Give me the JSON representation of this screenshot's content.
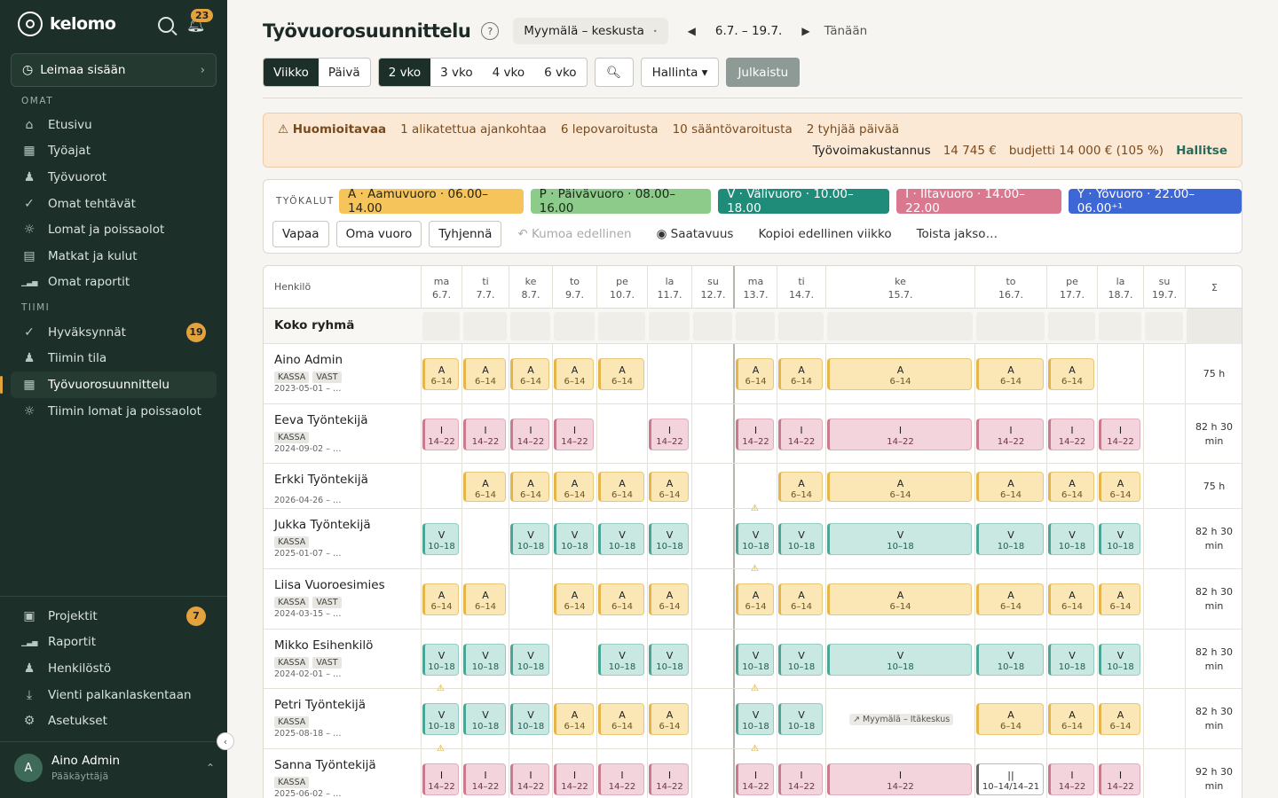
{
  "sidebar": {
    "brand": "kelomo",
    "notif_count": "23",
    "clock_in": "Leimaa sisään",
    "section_own": "OMAT",
    "own_items": [
      {
        "label": "Etusivu",
        "icon": "home-icon"
      },
      {
        "label": "Työajat",
        "icon": "calendar-icon"
      },
      {
        "label": "Työvuorot",
        "icon": "people-icon"
      },
      {
        "label": "Omat tehtävät",
        "icon": "check-icon"
      },
      {
        "label": "Lomat ja poissaolot",
        "icon": "sun-icon"
      },
      {
        "label": "Matkat ja kulut",
        "icon": "receipt-icon"
      },
      {
        "label": "Omat raportit",
        "icon": "bar-chart-icon"
      }
    ],
    "section_team": "TIIMI",
    "team_items": [
      {
        "label": "Hyväksynnät",
        "icon": "check-icon",
        "badge": "19"
      },
      {
        "label": "Tiimin tila",
        "icon": "people-icon"
      },
      {
        "label": "Työvuorosuunnittelu",
        "icon": "calendar-icon",
        "active": true
      },
      {
        "label": "Tiimin lomat ja poissaolot",
        "icon": "sun-icon"
      }
    ],
    "bottom_items": [
      {
        "label": "Projektit",
        "icon": "briefcase-icon",
        "badge": "7"
      },
      {
        "label": "Raportit",
        "icon": "bar-chart-icon"
      },
      {
        "label": "Henkilöstö",
        "icon": "people-icon"
      },
      {
        "label": "Vienti palkanlaskentaan",
        "icon": "download-icon"
      },
      {
        "label": "Asetukset",
        "icon": "gear-icon"
      }
    ],
    "user": {
      "initial": "A",
      "name": "Aino Admin",
      "role": "Pääkäyttäjä"
    }
  },
  "header": {
    "title": "Työvuorosuunnittelu",
    "help": "?",
    "store": "Myymälä – keskusta",
    "range": "6.7. – 19.7.",
    "today": "Tänään"
  },
  "toolbar": {
    "view": [
      "Viikko",
      "Päivä"
    ],
    "span": [
      "2 vko",
      "3 vko",
      "4 vko",
      "6 vko"
    ],
    "manage": "Hallinta ▾",
    "publish": "Julkaistu"
  },
  "alert": {
    "heading": "⚠ Huomioitavaa",
    "items": [
      "1 alikatettua ajankohtaa",
      "6 lepovaroitusta",
      "10 sääntövaroitusta",
      "2 tyhjää päivää"
    ],
    "cost_label": "Työvoimakustannus",
    "cost": "14 745 €",
    "budget": "budjetti 14 000 € (105 %)",
    "manage": "Hallitse"
  },
  "tools": {
    "label": "TYÖKALUT",
    "shift_types": [
      {
        "label": "A · Aamuvuoro · 06.00–14.00",
        "bg": "#f5c45a",
        "fg": "#2a2410"
      },
      {
        "label": "P · Päivävuoro · 08.00–16.00",
        "bg": "#8ccb8a",
        "fg": "#152a14"
      },
      {
        "label": "V · Välivuoro · 10.00–18.00",
        "bg": "#1f8c7a",
        "fg": "#ffffff"
      },
      {
        "label": "I · Iltavuoro · 14.00–22.00",
        "bg": "#d9788e",
        "fg": "#ffffff"
      },
      {
        "label": "Y · Yövuoro · 22.00–06.00⁺¹",
        "bg": "#3e67d6",
        "fg": "#ffffff"
      }
    ],
    "buttons": [
      "Vapaa",
      "Oma vuoro",
      "Tyhjennä"
    ],
    "undo": "↶ Kumoa edellinen",
    "availability": "Saatavuus",
    "copy_prev": "Kopioi edellinen viikko",
    "repeat": "Toista jakso…"
  },
  "schedule": {
    "person_header": "Henkilö",
    "sum_header": "Σ",
    "days": [
      {
        "d": "ma",
        "date": "6.7."
      },
      {
        "d": "ti",
        "date": "7.7."
      },
      {
        "d": "ke",
        "date": "8.7."
      },
      {
        "d": "to",
        "date": "9.7."
      },
      {
        "d": "pe",
        "date": "10.7."
      },
      {
        "d": "la",
        "date": "11.7."
      },
      {
        "d": "su",
        "date": "12.7."
      },
      {
        "d": "ma",
        "date": "13.7."
      },
      {
        "d": "ti",
        "date": "14.7."
      },
      {
        "d": "ke",
        "date": "15.7."
      },
      {
        "d": "to",
        "date": "16.7."
      },
      {
        "d": "pe",
        "date": "17.7."
      },
      {
        "d": "la",
        "date": "18.7."
      },
      {
        "d": "su",
        "date": "19.7."
      }
    ],
    "group": "Koko ryhmä",
    "people": [
      {
        "name": "Aino Admin",
        "tags": [
          "KASSA",
          "VAST"
        ],
        "since": "2023-05-01 – …",
        "total": "75 h",
        "shifts": [
          "A|6–14",
          "A|6–14",
          "A|6–14",
          "A|6–14",
          "A|6–14",
          "",
          "",
          "A|6–14",
          "A|6–14",
          "A|6–14",
          "A|6–14",
          "A|6–14",
          "",
          ""
        ]
      },
      {
        "name": "Eeva Työntekijä",
        "tags": [
          "KASSA"
        ],
        "since": "2024-09-02 – …",
        "total": "82 h 30 min",
        "shifts": [
          "I|14–22",
          "I|14–22",
          "I|14–22",
          "I|14–22",
          "",
          "I|14–22",
          "",
          "I|14–22",
          "I|14–22",
          "I|14–22",
          "I|14–22",
          "I|14–22",
          "I|14–22",
          ""
        ]
      },
      {
        "name": "Erkki Työntekijä",
        "tags": [],
        "since": "2026-04-26 – …",
        "total": "75 h",
        "shifts": [
          "",
          "A|6–14",
          "A|6–14",
          "A|6–14",
          "A|6–14",
          "A|6–14",
          "",
          "",
          "A|6–14",
          "A|6–14",
          "A|6–14",
          "A|6–14",
          "A|6–14",
          ""
        ]
      },
      {
        "name": "Jukka Työntekijä",
        "tags": [
          "KASSA"
        ],
        "since": "2025-01-07 – …",
        "total": "82 h 30 min",
        "warn": [
          7
        ],
        "shifts": [
          "V|10–18",
          "",
          "V|10–18",
          "V|10–18",
          "V|10–18",
          "V|10–18",
          "",
          "V|10–18",
          "V|10–18",
          "V|10–18",
          "V|10–18",
          "V|10–18",
          "V|10–18",
          ""
        ]
      },
      {
        "name": "Liisa Vuoroesimies",
        "tags": [
          "KASSA",
          "VAST"
        ],
        "since": "2024-03-15 – …",
        "total": "82 h 30 min",
        "warn": [
          7
        ],
        "shifts": [
          "A|6–14",
          "A|6–14",
          "",
          "A|6–14",
          "A|6–14",
          "A|6–14",
          "",
          "A|6–14",
          "A|6–14",
          "A|6–14",
          "A|6–14",
          "A|6–14",
          "A|6–14",
          ""
        ]
      },
      {
        "name": "Mikko Esihenkilö",
        "tags": [
          "KASSA",
          "VAST"
        ],
        "since": "2024-02-01 – …",
        "total": "82 h 30 min",
        "shifts": [
          "V|10–18",
          "V|10–18",
          "V|10–18",
          "",
          "V|10–18",
          "V|10–18",
          "",
          "V|10–18",
          "V|10–18",
          "V|10–18",
          "V|10–18",
          "V|10–18",
          "V|10–18",
          ""
        ]
      },
      {
        "name": "Petri Työntekijä",
        "tags": [
          "KASSA"
        ],
        "since": "2025-08-18 – …",
        "total": "82 h 30 min",
        "warn": [
          0,
          7
        ],
        "loc": "↗ Myymälä – Itäkeskus",
        "shifts": [
          "V|10–18",
          "V|10–18",
          "V|10–18",
          "A|6–14",
          "A|6–14",
          "A|6–14",
          "",
          "V|10–18",
          "V|10–18",
          "LOC",
          "A|6–14",
          "A|6–14",
          "A|6–14",
          ""
        ]
      },
      {
        "name": "Sanna Työntekijä",
        "tags": [
          "KASSA"
        ],
        "since": "2025-06-02 – …",
        "total": "92 h 30 min",
        "warn": [
          0,
          7
        ],
        "shifts": [
          "I|14–22",
          "I|14–22",
          "I|14–22",
          "I|14–22",
          "I|14–22",
          "I|14–22",
          "",
          "I|14–22",
          "I|14–22",
          "I|14–22",
          "II|10–14/14–21",
          "I|14–22",
          "I|14–22",
          ""
        ]
      }
    ]
  }
}
